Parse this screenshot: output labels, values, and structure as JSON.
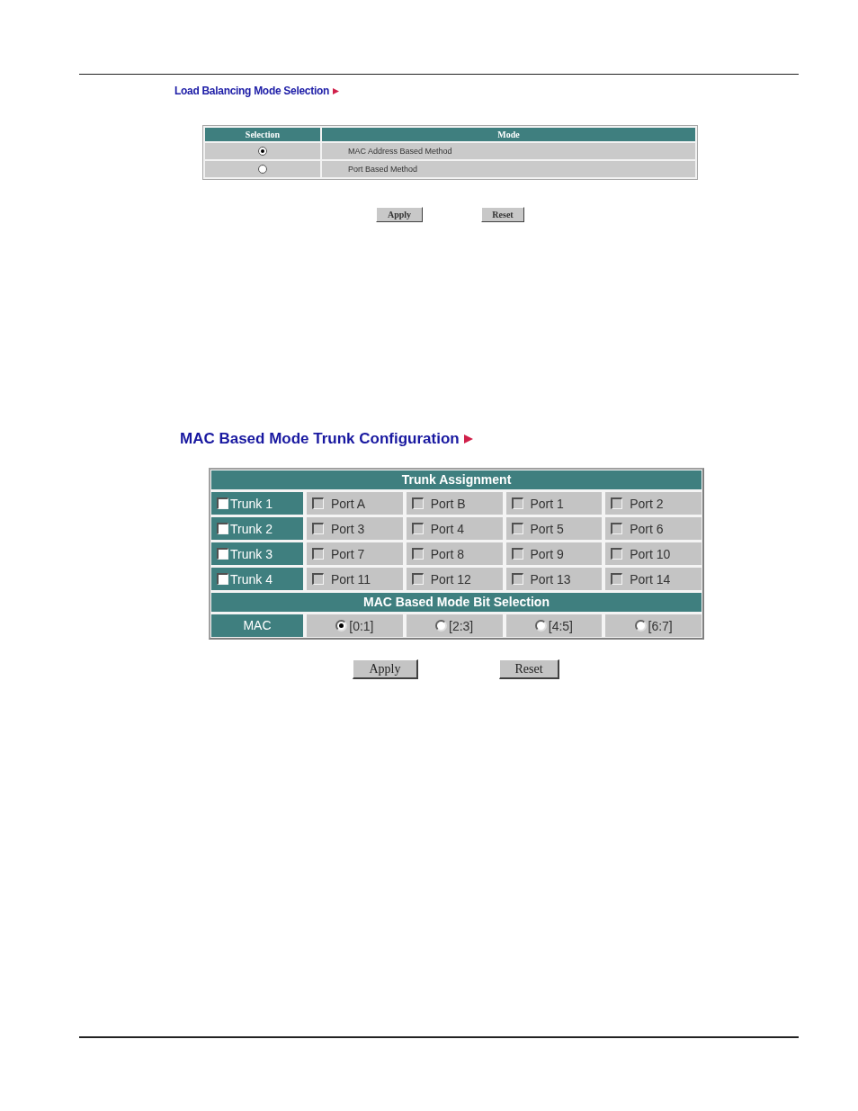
{
  "load_balancing": {
    "title": "Load Balancing Mode Selection",
    "columns": [
      "Selection",
      "Mode"
    ],
    "rows": [
      {
        "mode": "MAC Address Based Method",
        "selected": true
      },
      {
        "mode": "Port Based Method",
        "selected": false
      }
    ],
    "buttons": [
      "Apply",
      "Reset"
    ]
  },
  "trunk_configuration": {
    "title": "MAC Based Mode Trunk Configuration",
    "trunk_header": "Trunk Assignment",
    "trunks": [
      {
        "label": "Trunk 1",
        "checked": false,
        "ports": [
          {
            "label": "Port A",
            "checked": false
          },
          {
            "label": "Port B",
            "checked": false
          },
          {
            "label": "Port 1",
            "checked": false
          },
          {
            "label": "Port 2",
            "checked": false
          }
        ]
      },
      {
        "label": "Trunk 2",
        "checked": false,
        "ports": [
          {
            "label": "Port 3",
            "checked": false
          },
          {
            "label": "Port 4",
            "checked": false
          },
          {
            "label": "Port 5",
            "checked": false
          },
          {
            "label": "Port 6",
            "checked": false
          }
        ]
      },
      {
        "label": "Trunk 3",
        "checked": false,
        "ports": [
          {
            "label": "Port 7",
            "checked": false
          },
          {
            "label": "Port 8",
            "checked": false
          },
          {
            "label": "Port 9",
            "checked": false
          },
          {
            "label": "Port 10",
            "checked": false
          }
        ]
      },
      {
        "label": "Trunk 4",
        "checked": false,
        "ports": [
          {
            "label": "Port 11",
            "checked": false
          },
          {
            "label": "Port 12",
            "checked": false
          },
          {
            "label": "Port 13",
            "checked": false
          },
          {
            "label": "Port 14",
            "checked": false
          }
        ]
      }
    ],
    "bit_header": "MAC Based Mode Bit Selection",
    "bit_row": {
      "label": "MAC",
      "options": [
        {
          "label": "[0:1]",
          "selected": true
        },
        {
          "label": "[2:3]",
          "selected": false
        },
        {
          "label": "[4:5]",
          "selected": false
        },
        {
          "label": "[6:7]",
          "selected": false
        }
      ]
    },
    "buttons": [
      "Apply",
      "Reset"
    ]
  }
}
